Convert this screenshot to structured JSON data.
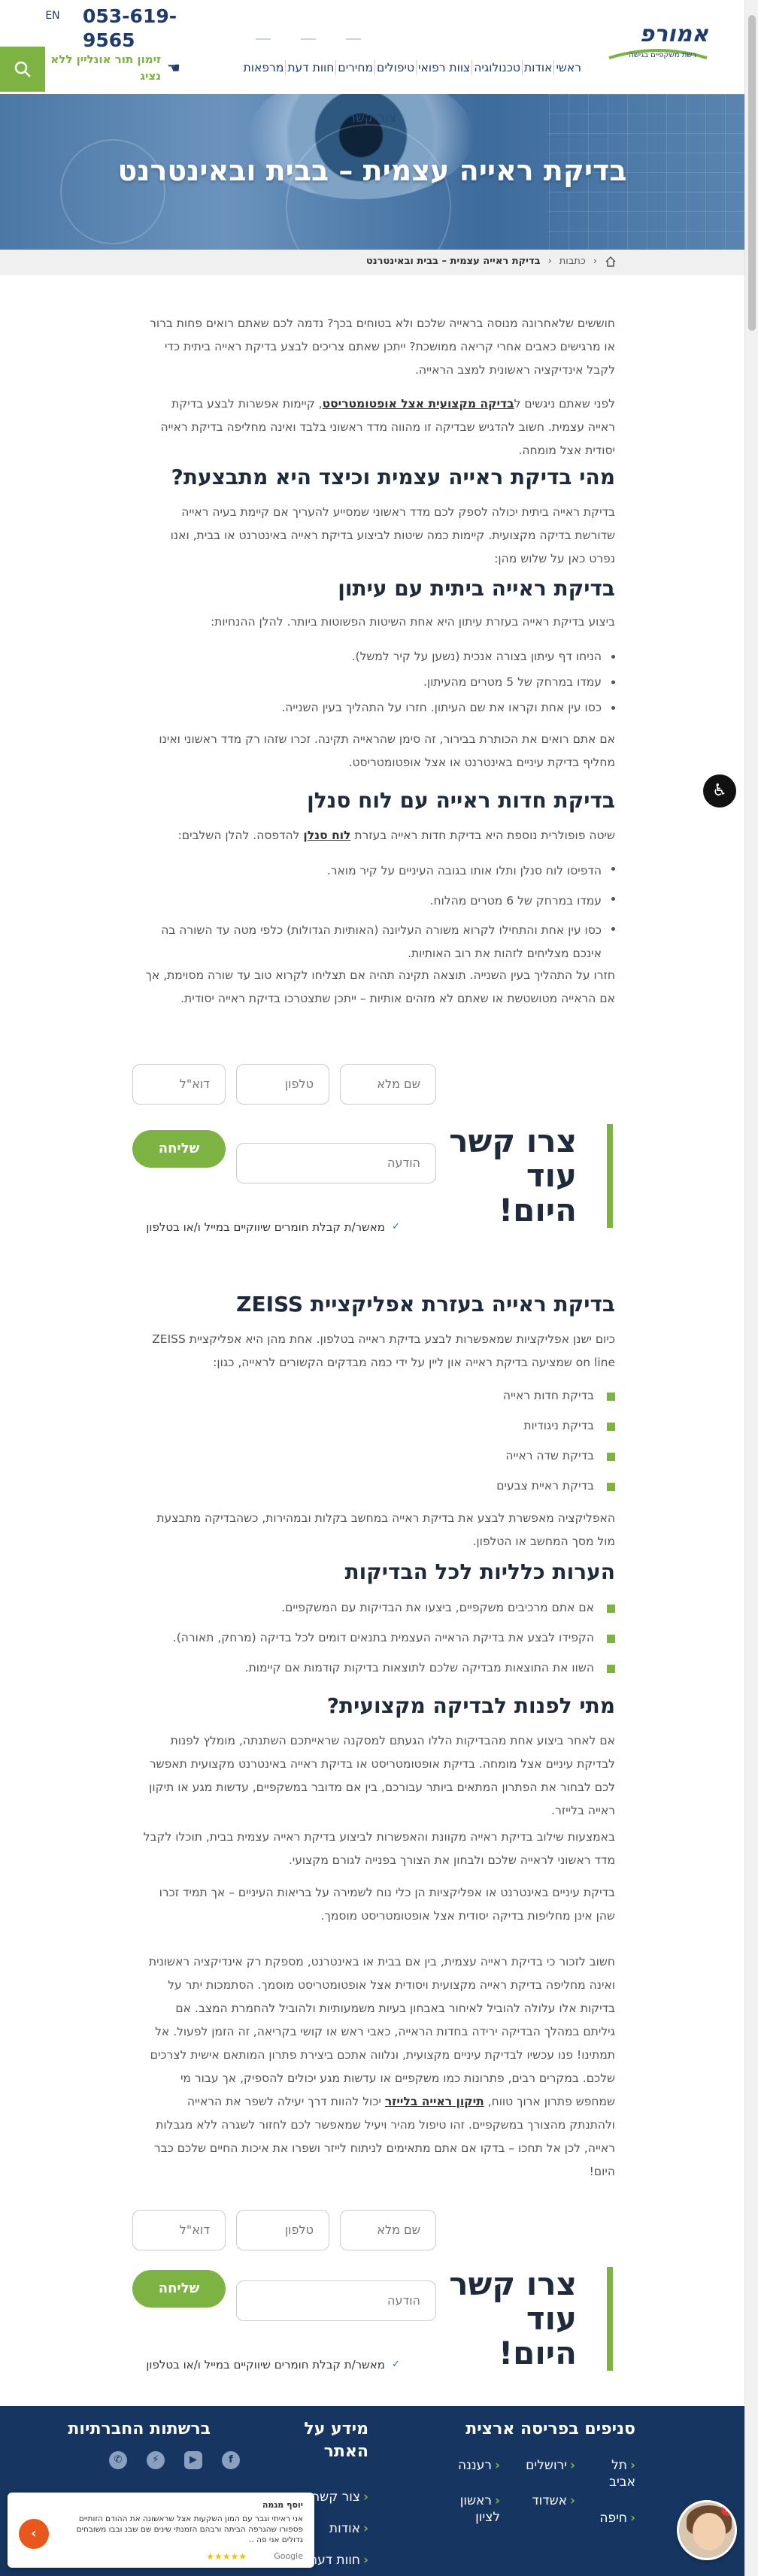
{
  "header": {
    "logo_text": "אמורפ",
    "logo_sub": "רשת משקפיים בגישה",
    "logo_brand": "אופטיקה",
    "phone": "053-619-9565",
    "lang": "EN",
    "lang2": "",
    "online_button": "זימון תור אונליין ללא נציג",
    "nav": [
      "ראשי",
      "אודות",
      "טכנולוגיה",
      "צוות רפואי",
      "טיפולים",
      "מחירים",
      "חוות דעת",
      "מרפאות"
    ]
  },
  "hero": {
    "breadcrumb_label": "צור קשר",
    "title": "בדיקת ראייה עצמית – בבית ובאינטרנט"
  },
  "breadcrumb": {
    "items": [
      "כתבות",
      "בדיקת ראייה עצמית – בבית ובאינטרנט"
    ]
  },
  "article": {
    "intro1": "חוששים שלאחרונה מנוסה בראייה שלכם ולא בטוחים בכך? נדמה לכם שאתם רואים פחות ברור או מרגישים כאבים אחרי קריאה ממושכת? ייתכן שאתם צריכים לבצע בדיקת ראייה ביתית כדי לקבל אינדיקציה ראשונית למצב הראייה.",
    "intro2_pre": "לפני שאתם ניגשים ל",
    "intro2_link": "בדיקה מקצועית אצל אופטומטריסט",
    "intro2_post": ", קיימות אפשרות לבצע בדיקת ראייה עצמית. חשוב להדגיש שבדיקה זו מהווה מדד ראשוני בלבד ואינה מחליפה בדיקת ראייה יסודית אצל מומחה.",
    "h_what": "מהי בדיקת ראייה עצמית וכיצד היא מתבצעת?",
    "p_what": "בדיקת ראייה ביתית יכולה לספק לכם מדד ראשוני שמסייע להעריך אם קיימת בעיה ראייה שדורשת בדיקה מקצועית. קיימות כמה שיטות לביצוע בדיקת ראייה באינטרנט או בבית, ואנו נפרט כאן על שלוש מהן:",
    "h_newspaper": "בדיקת ראייה ביתית עם עיתון",
    "p_newspaper": "ביצוע בדיקת ראייה בעזרת עיתון היא אחת השיטות הפשוטות ביותר. להלן ההנחיות:",
    "list_newspaper": [
      "הניחו דף עיתון בצורה אנכית (נשען על קיר למשל).",
      "עמדו במרחק של 5 מטרים מהעיתון.",
      "כסו עין אחת וקראו את שם העיתון. חזרו על התהליך בעין השנייה."
    ],
    "p_newspaper2": "אם אתם רואים את הכותרת בבירור, זה סימן שהראייה תקינה. זכרו שזהו רק מדד ראשוני ואינו מחליף בדיקת עיניים באינטרנט או אצל אופטומטריסט.",
    "h_snellen": "בדיקת חדות ראייה עם לוח סנלן",
    "p_snellen_pre": "שיטה פופולרית נוספת היא בדיקת חדות ראייה בעזרת ",
    "p_snellen_link": "לוח סנלן",
    "p_snellen_post": " להדפסה. להלן השלבים:",
    "list_snellen": [
      "הדפיסו לוח סנלן ותלו אותו בגובה העיניים על קיר מואר.",
      "עמדו במרחק של 6 מטרים מהלוח.",
      "כסו עין אחת והתחילו לקרוא משורה העליונה (האותיות הגדולות) כלפי מטה עד השורה בה אינכם מצליחים לזהות את רוב האותיות."
    ],
    "p_snellen2": "חזרו על התהליך בעין השנייה. תוצאה תקינה תהיה אם תצליחו לקרוא טוב עד שורה מסוימת, אך אם הראייה מטושטשת או שאתם לא מזהים אותיות – ייתכן שתצטרכו בדיקת ראייה יסודית.",
    "h_zeiss": "בדיקת ראייה בעזרת אפליקציית ZEISS",
    "p_zeiss": "כיום ישנן אפליקציות שמאפשרות לבצע בדיקת ראייה בטלפון. אחת מהן היא אפליקציית ZEISS on line שמציעה בדיקת ראייה און ליין על ידי כמה מבדקים הקשורים לראייה, כגון:",
    "list_zeiss": [
      "בדיקת חדות ראייה",
      "בדיקת ניגודיות",
      "בדיקת שדה ראייה",
      "בדיקת ראיית צבעים"
    ],
    "p_zeiss2": "האפליקציה מאפשרת לבצע את בדיקת ראייה במחשב בקלות ובמהירות, כשהבדיקה מתבצעת מול מסך המחשב או הטלפון.",
    "h_notes": "הערות כלליות לכל הבדיקות",
    "list_notes": [
      "אם אתם מרכיבים משקפיים, ביצעו את הבדיקות עם המשקפיים.",
      "הקפידו לבצע את בדיקת הראייה העצמית בתנאים דומים לכל בדיקה (מרחק, תאורה).",
      "השוו את התוצאות מבדיקה שלכם לתוצאות בדיקות קודמות אם קיימות."
    ],
    "h_when": "מתי לפנות לבדיקה מקצועית?",
    "p_when1": "אם לאחר ביצוע אחת מהבדיקות הללו הגעתם למסקנה שראייתכם השתנתה, מומלץ לפנות לבדיקת עיניים אצל מומחה. בדיקת אופטומטריסט או בדיקת ראייה באינטרנט מקצועית תאפשר לכם לבחור את הפתרון המתאים ביותר עבורכם, בין אם מדובר במשקפיים, עדשות מגע או תיקון ראייה בלייזר.",
    "p_when2": "באמצעות שילוב בדיקת ראייה מקוונת והאפשרות לביצוע בדיקת ראייה עצמית בבית, תוכלו לקבל מדד ראשוני לראייה שלכם ולבחון את הצורך בפנייה לגורם מקצועי.",
    "p_when3": "בדיקת עיניים באינטרנט או אפליקציות הן כלי נוח לשמירה על בריאות העיניים – אך תמיד זכרו שהן אינן מחליפות בדיקה יסודית אצל אופטומטריסט מוסמך.",
    "p_final_pre": "חשוב לזכור כי בדיקת ראייה עצמית, בין אם בבית או באינטרנט, מספקת רק אינדיקציה ראשונית ואינה מחליפה בדיקת ראייה מקצועית ויסודית אצל אופטומטריסט מוסמך. הסתמכות יתר על בדיקות אלו עלולה להוביל לאיחור באבחון בעיות משמעותיות ולהוביל להחמרת המצב. אם גיליתם במהלך הבדיקה ירידה בחדות הראייה, כאבי ראש או קושי בקריאה, זה הזמן לפעול. אל תמתינו! פנו עכשיו לבדיקת עיניים מקצועית, ונלווה אתכם ביצירת פתרון המותאם אישית לצרכים שלכם. במקרים רבים, פתרונות כמו משקפיים או עדשות מגע יכולים להספיק, אך עבור מי שמחפש פתרון ארוך טווח, ",
    "p_final_link": "תיקון ראייה בלייזר",
    "p_final_post": " יכול להוות דרך יעילה לשפר את הראייה ולהתנתק מהצורך במשקפיים. זהו טיפול מהיר ויעיל שמאפשר לכם לחזור לשגרה ללא מגבלות ראייה, לכן אל תחכו – בדקו אם אתם מתאימים לניתוח לייזר ושפרו את איכות החיים שלכם כבר היום!"
  },
  "form": {
    "title": "צרו קשר עוד היום!",
    "name_placeholder": "שם מלא",
    "phone_placeholder": "טלפון",
    "email_placeholder": "דוא\"ל",
    "message_placeholder": "הודעה",
    "send": "שליחה",
    "consent": "מאשר/ת קבלת חומרים שיווקיים במייל ו/או בטלפון"
  },
  "footer": {
    "branches_title": "סניפים בפריסה ארצית",
    "branches": [
      "תל אביב",
      "ירושלים",
      "רעננה",
      "חיפה",
      "אשדוד",
      "ראשון לציון"
    ],
    "info_title": "מידע על האתר",
    "info_links": [
      "צור קשר",
      "אודות",
      "חוות דעת"
    ],
    "social_title": "ברשתות החברתיות",
    "social_icons": [
      "facebook-icon",
      "youtube-icon",
      "messenger-icon",
      "whatsapp-icon"
    ]
  },
  "review": {
    "name": "יוסף מגמה",
    "text": "אני ראיתי וגבר עם המון השקעות אצל שראשונה את ההודם הזותיים פספורו שהגרפה הביתה ורבהם הזמנתי שינים שם שבנ ובבו משובחים גדולים אני פה ..",
    "google": "Google",
    "stars": "★★★★★"
  },
  "colors": {
    "brand": "#1f3b6e",
    "accent": "#7cb342",
    "footer": "#163661"
  }
}
